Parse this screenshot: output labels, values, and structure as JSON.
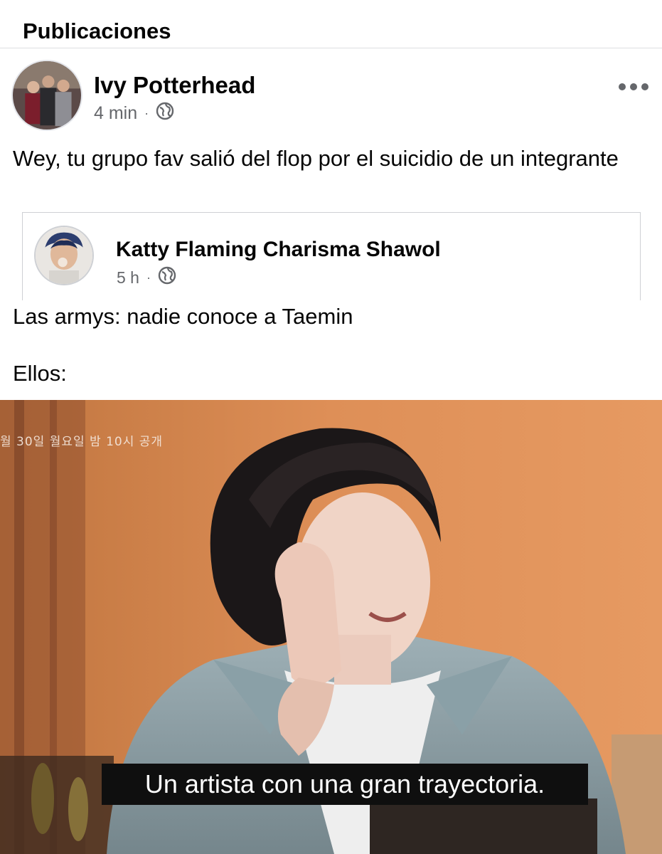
{
  "header": {
    "title": "Publicaciones"
  },
  "post": {
    "author": "Ivy Potterhead",
    "time": "4 min",
    "separator": "·",
    "visibility_icon": "globe-icon",
    "more_icon": "more-options-icon",
    "text": "Wey, tu grupo fav salió del flop por el suicidio de un integrante"
  },
  "shared_post": {
    "author": "Katty Flaming Charisma Shawol",
    "time": "5 h",
    "separator": "·",
    "visibility_icon": "globe-icon",
    "line1": "Las armys: nadie conoce a Taemin",
    "line2": "Ellos:"
  },
  "image": {
    "korean_caption": "월 30일 월요일 밤 10시 공개",
    "subtitle": "Un artista con una gran trayectoria."
  },
  "colors": {
    "secondary_text": "#65676b",
    "background_wall": "#d98a55",
    "subtitle_bg": "#0f0f0f"
  }
}
